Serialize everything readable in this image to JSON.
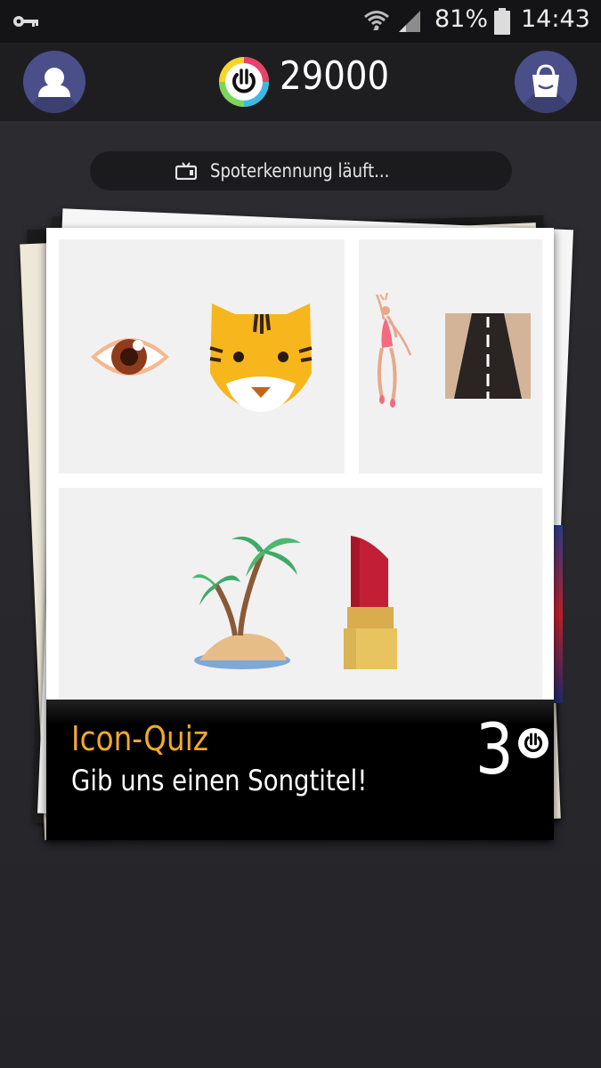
{
  "status_bar": {
    "battery_percent": "81%",
    "time": "14:43",
    "icons": [
      "key-icon",
      "wifi-icon",
      "signal-icon",
      "battery-icon"
    ]
  },
  "top_bar": {
    "coin_count": "29000",
    "icons": [
      "profile-icon",
      "coin-power-icon",
      "shopping-bag-icon"
    ],
    "accent_color": "#4a4f8a"
  },
  "recognition": {
    "status_text": "Spoterkennung läuft..."
  },
  "quiz_card": {
    "title": "Icon-Quiz",
    "subtitle": "Gib uns einen Songtitel!",
    "cost": "3",
    "title_color": "#f0a830",
    "panels": [
      {
        "icons": [
          "eye-icon",
          "tiger-icon"
        ]
      },
      {
        "icons": [
          "dancer-icon",
          "road-icon"
        ]
      },
      {
        "icons": [
          "palm-island-icon",
          "lipstick-icon"
        ]
      }
    ]
  }
}
